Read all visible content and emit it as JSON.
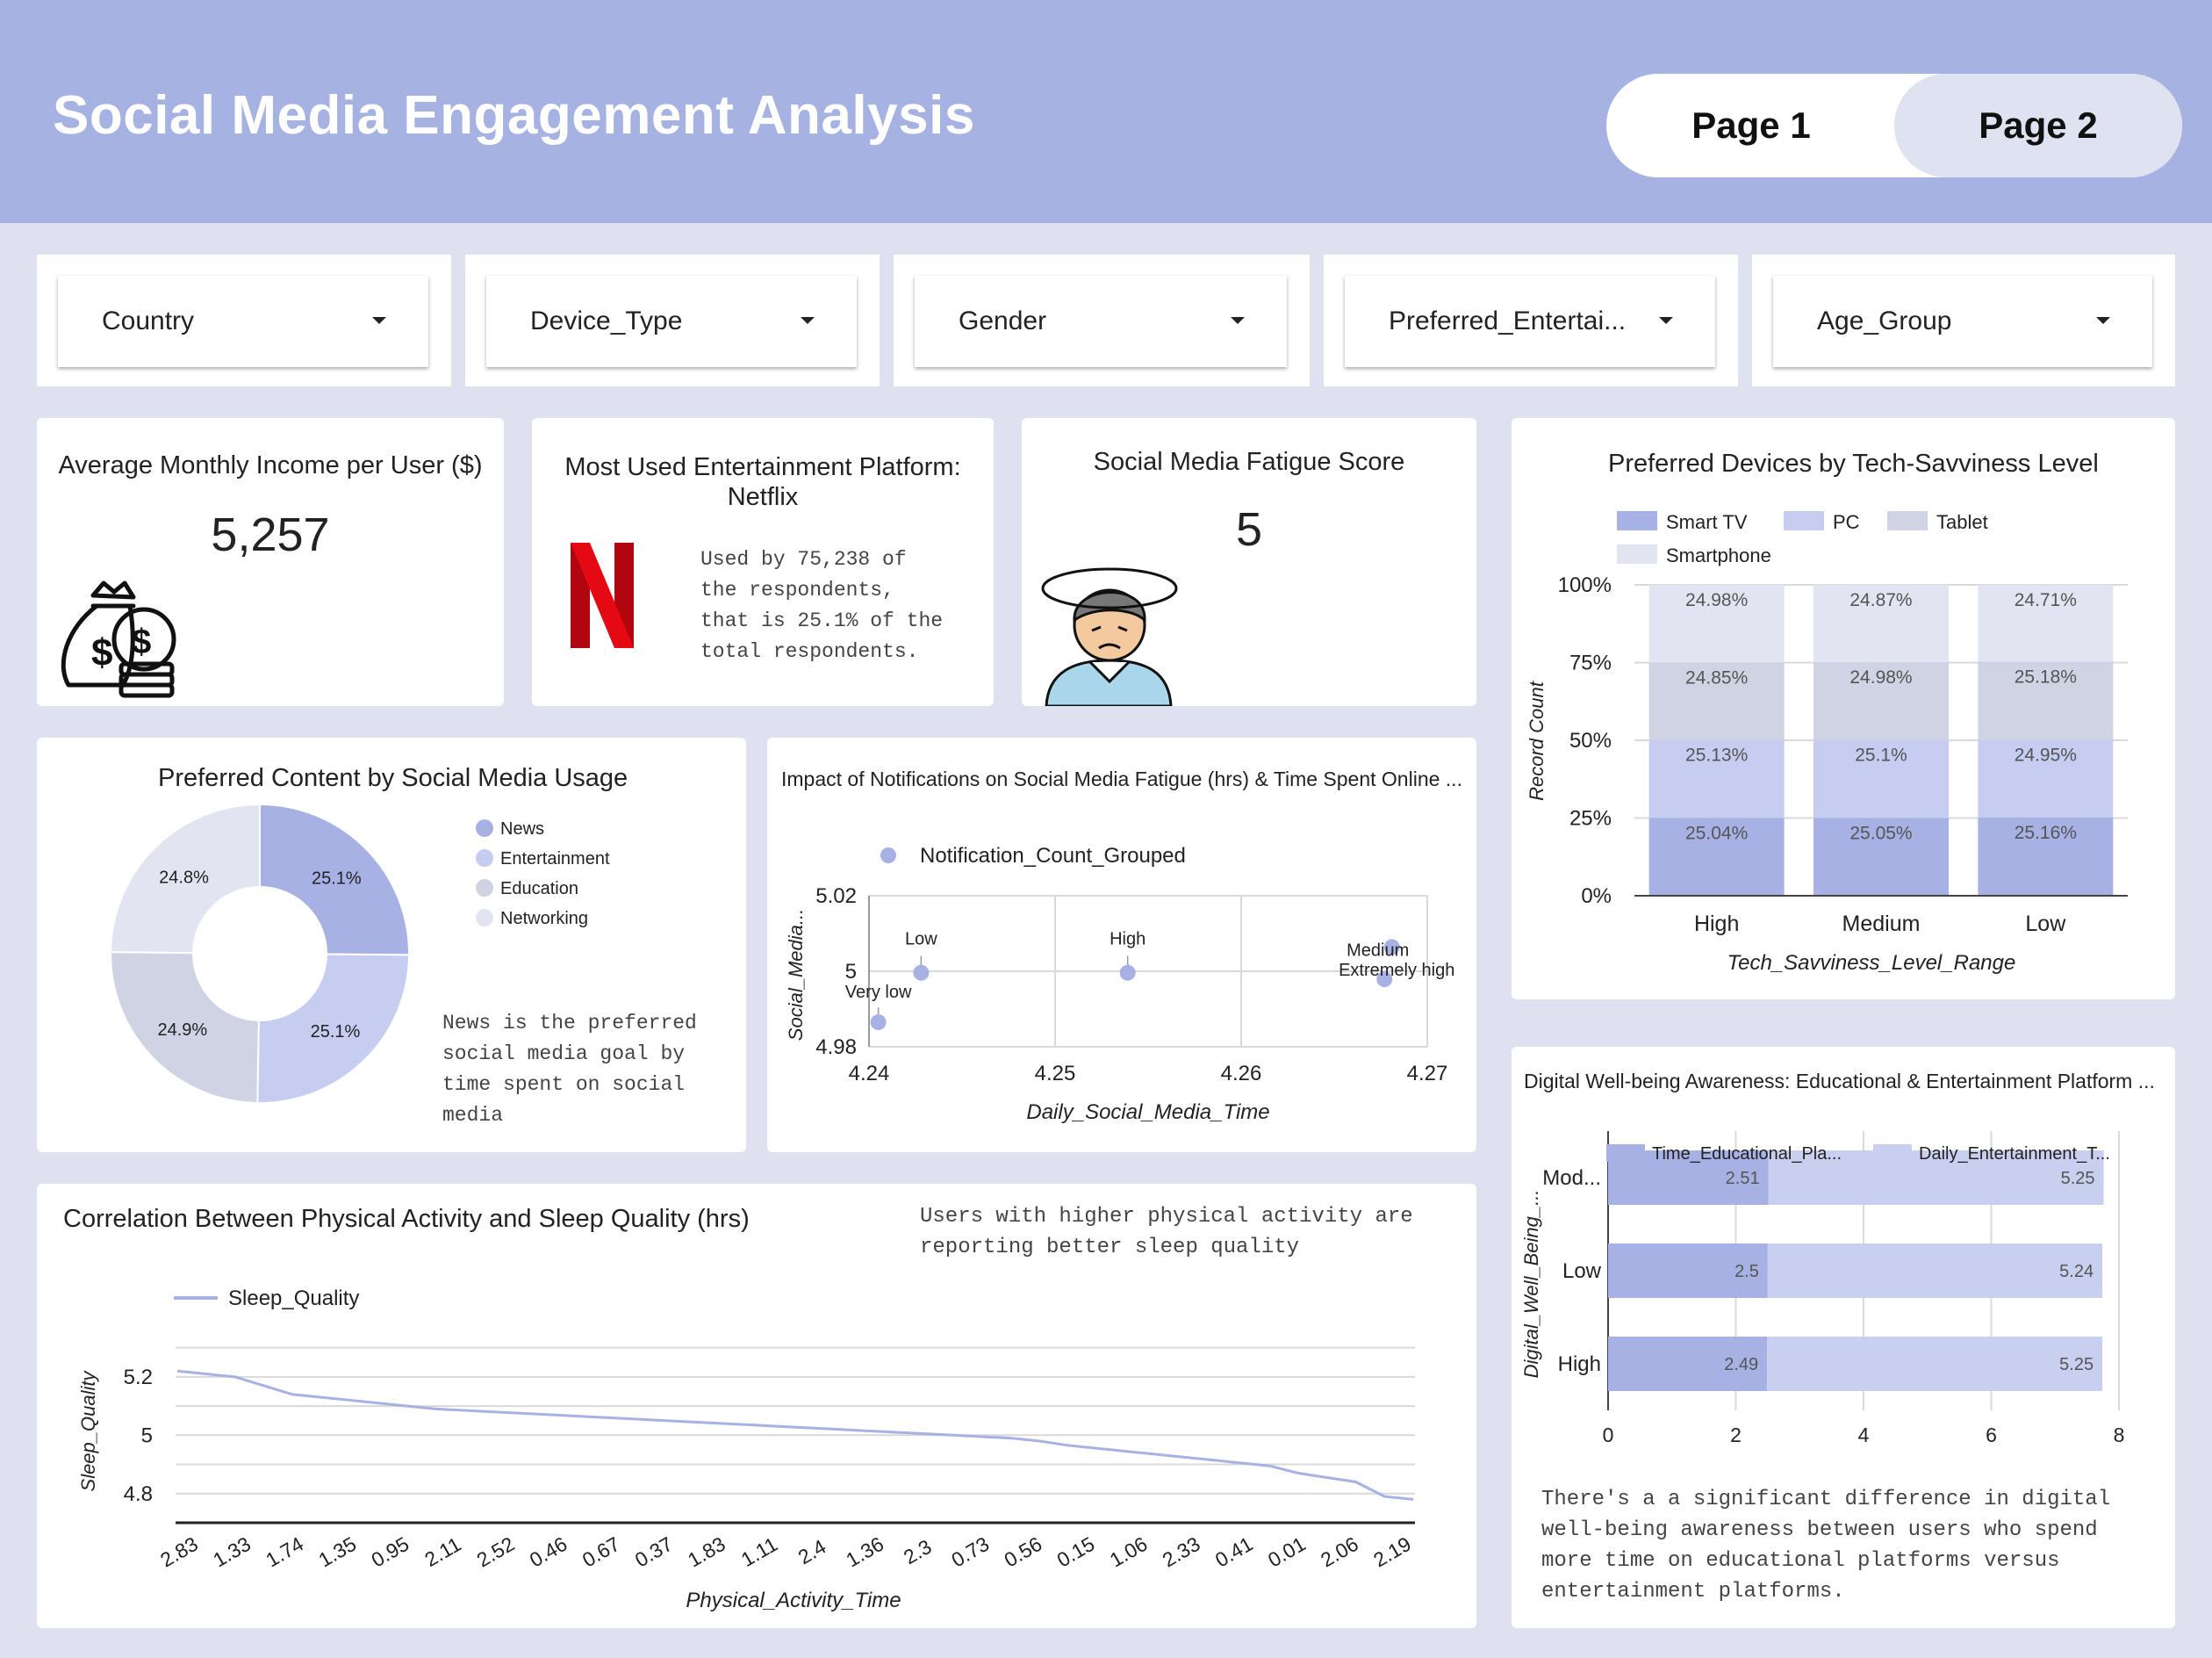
{
  "header": {
    "title": "Social Media Engagement Analysis",
    "page1": "Page 1",
    "page2": "Page 2"
  },
  "filters": [
    "Country",
    "Device_Type",
    "Gender",
    "Preferred_Entertai...",
    "Age_Group"
  ],
  "kpi_income": {
    "title": "Average Monthly Income per User ($)",
    "value": "5,257",
    "icon": "money-bag-icon"
  },
  "kpi_platform": {
    "title_line1": "Most Used Entertainment Platform:",
    "title_line2": "Netflix",
    "note_lines": [
      "Used by 75,238 of",
      "the respondents,",
      "that is 25.1% of the",
      "total respondents."
    ],
    "icon": "netflix-logo"
  },
  "kpi_fatigue": {
    "title": "Social Media Fatigue Score",
    "value": "5",
    "icon": "dizzy-person-icon"
  },
  "colors": {
    "header": "#a6b2e2",
    "background": "#dfe1f0",
    "series1": "#a7b1e3",
    "series2": "#c6cdf1",
    "series3": "#cfd3e4",
    "series4": "#e2e4f2"
  },
  "chart_data": [
    {
      "id": "donut",
      "type": "pie",
      "title": "Preferred Content by Social Media Usage",
      "slices": [
        {
          "name": "News",
          "value": 25.1,
          "label": "25.1%"
        },
        {
          "name": "Entertainment",
          "value": 25.1,
          "label": "25.1%"
        },
        {
          "name": "Education",
          "value": 24.9,
          "label": "24.9%"
        },
        {
          "name": "Networking",
          "value": 24.8,
          "label": "24.8%"
        }
      ],
      "legend": "right",
      "note_lines": [
        "News is the preferred",
        "social media goal by",
        "time spent on social",
        "media"
      ]
    },
    {
      "id": "scatter",
      "type": "scatter",
      "title": "Impact of Notifications on Social Media Fatigue (hrs) & Time Spent Online ...",
      "legend_label": "Notification_Count_Grouped",
      "xlabel": "Daily_Social_Media_Time",
      "ylabel": "Social_Media...",
      "xlim": [
        4.24,
        4.27
      ],
      "ylim": [
        4.98,
        5.02
      ],
      "xticks": [
        "4.24",
        "4.25",
        "4.26",
        "4.27"
      ],
      "yticks": [
        "5.02",
        "5",
        "4.98"
      ],
      "points": [
        {
          "label": "Very low",
          "x": 4.2405,
          "y": 4.9865
        },
        {
          "label": "Low",
          "x": 4.2428,
          "y": 4.9996
        },
        {
          "label": "High",
          "x": 4.2539,
          "y": 4.9996
        },
        {
          "label": "Medium",
          "x": 4.2681,
          "y": 5.0064
        },
        {
          "label": "Extremely high",
          "x": 4.2677,
          "y": 4.9979
        }
      ]
    },
    {
      "id": "stacked",
      "type": "bar",
      "title": "Preferred Devices by Tech-Savviness Level",
      "categories": [
        "High",
        "Medium",
        "Low"
      ],
      "series": [
        {
          "name": "Smart TV",
          "values": [
            25.04,
            25.05,
            25.16
          ],
          "labels": [
            "25.04%",
            "25.05%",
            "25.16%"
          ]
        },
        {
          "name": "PC",
          "values": [
            25.13,
            25.1,
            24.95
          ],
          "labels": [
            "25.13%",
            "25.1%",
            "24.95%"
          ]
        },
        {
          "name": "Tablet",
          "values": [
            24.85,
            24.98,
            25.18
          ],
          "labels": [
            "24.85%",
            "24.98%",
            "25.18%"
          ]
        },
        {
          "name": "Smartphone",
          "values": [
            24.98,
            24.87,
            24.71
          ],
          "labels": [
            "24.98%",
            "24.87%",
            "24.71%"
          ]
        }
      ],
      "xlabel": "Tech_Savviness_Level_Range",
      "ylabel": "Record Count",
      "yticks": [
        "0%",
        "25%",
        "50%",
        "75%",
        "100%"
      ],
      "ylim": [
        0,
        100
      ],
      "legend": "top"
    },
    {
      "id": "line",
      "type": "line",
      "title": "Correlation Between Physical Activity and Sleep Quality (hrs)",
      "note_lines": [
        "Users with higher physical activity are",
        "reporting better sleep quality"
      ],
      "legend_label": "Sleep_Quality",
      "xlabel": "Physical_Activity_Time",
      "ylabel": "Sleep_Quality",
      "ylim": [
        4.7,
        5.35
      ],
      "yticks": [
        "5.2",
        "5",
        "4.8"
      ],
      "xticks": [
        "2.83",
        "1.33",
        "1.74",
        "1.35",
        "0.95",
        "2.11",
        "2.52",
        "0.46",
        "0.67",
        "0.37",
        "1.83",
        "1.11",
        "2.4",
        "1.36",
        "2.3",
        "0.73",
        "0.56",
        "0.15",
        "1.06",
        "2.33",
        "0.41",
        "0.01",
        "2.06",
        "2.19"
      ],
      "values": [
        5.22,
        5.21,
        5.2,
        5.17,
        5.14,
        5.13,
        5.12,
        5.11,
        5.1,
        5.09,
        5.085,
        5.08,
        5.075,
        5.07,
        5.065,
        5.06,
        5.055,
        5.05,
        5.045,
        5.04,
        5.035,
        5.03,
        5.025,
        5.02,
        5.015,
        5.01,
        5.005,
        5.0,
        4.995,
        4.99,
        4.98,
        4.965,
        4.955,
        4.945,
        4.935,
        4.925,
        4.915,
        4.905,
        4.895,
        4.87,
        4.855,
        4.84,
        4.79,
        4.78
      ]
    },
    {
      "id": "hbar",
      "type": "bar",
      "orientation": "horizontal",
      "title": "Digital Well-being Awareness: Educational & Entertainment Platform ...",
      "categories": [
        "Mod...",
        "Low",
        "High"
      ],
      "series": [
        {
          "name": "Time_Educational_Pla...",
          "values": [
            2.51,
            2.5,
            2.49
          ]
        },
        {
          "name": "Daily_Entertainment_T...",
          "values": [
            5.25,
            5.24,
            5.25
          ]
        }
      ],
      "xlim": [
        0,
        8
      ],
      "xticks": [
        "0",
        "2",
        "4",
        "6",
        "8"
      ],
      "ylabel": "Digital_Well_Being_...",
      "note_lines": [
        "There's a a significant difference in digital",
        "well-being awareness between users who spend",
        "more time on educational platforms versus",
        "entertainment platforms."
      ],
      "legend": "top"
    }
  ]
}
